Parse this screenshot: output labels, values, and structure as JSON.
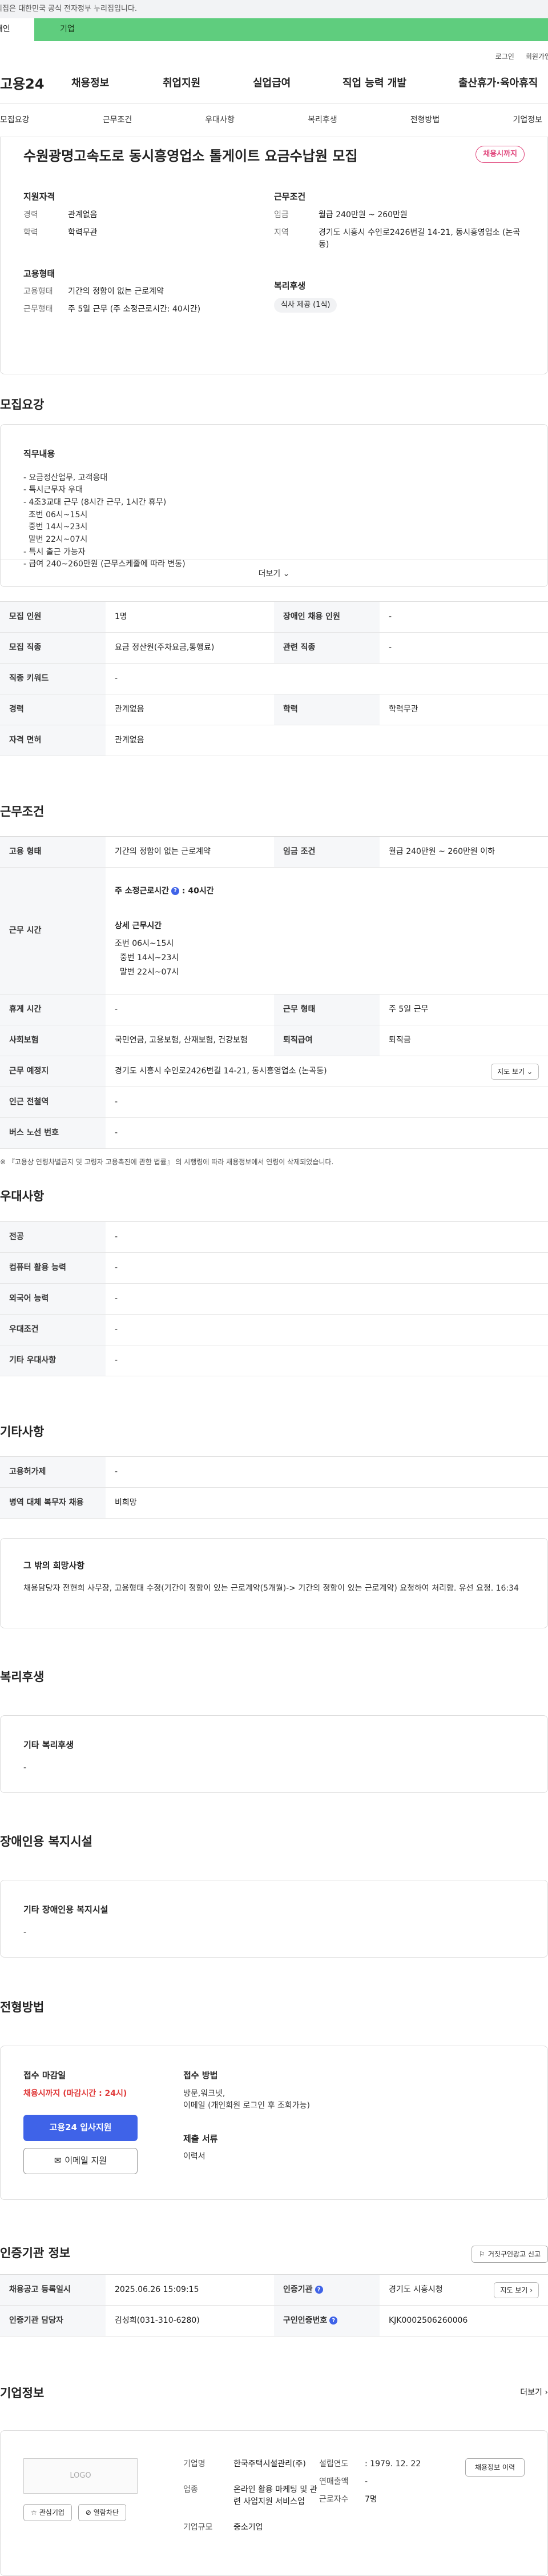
{
  "gov_banner": "이 누리집은 대한민국 공식 전자정부 누리집입니다.",
  "top_tabs": {
    "individual": "개인",
    "company": "기업"
  },
  "util": {
    "login": "로그인",
    "signup": "회원가입"
  },
  "logo": "고용24",
  "gnb": [
    "채용정보",
    "취업지원",
    "실업급여",
    "직업 능력 개발",
    "출산휴가·육아휴직"
  ],
  "subnav": [
    "모집요강",
    "근무조건",
    "우대사항",
    "복리후생",
    "전형방법",
    "기업정보"
  ],
  "summary": {
    "title": "수원광명고속도로 동시흥영업소 톨게이트 요금수납원 모집",
    "status": "채용시까지",
    "qual_title": "지원자격",
    "career_k": "경력",
    "career_v": "관계없음",
    "edu_k": "학력",
    "edu_v": "학력무관",
    "emp_title": "고용형태",
    "emptype_k": "고용형태",
    "emptype_v": "기간의 정함이 없는 근로계약",
    "worktype_k": "근무형태",
    "worktype_v": "주 5일 근무 (주 소정근로시간: 40시간)",
    "cond_title": "근무조건",
    "wage_k": "임금",
    "wage_v": "월급 240만원 ~ 260만원",
    "area_k": "지역",
    "area_v": "경기도 시흥시 수인로2426번길 14-21, 동시흥영업소 (논곡동)",
    "welfare_title": "복리후생",
    "welfare_chip": "식사 제공 (1식)"
  },
  "recruit": {
    "section_title": "모집요강",
    "duty_title": "직무내용",
    "duty_lines": [
      "- 요금정산업무, 고객응대",
      "- 특시근무자 우대",
      "- 4조3교대 근무 (8시간 근무, 1시간 휴무)",
      "  조번 06시~15시",
      "  중번 14시~23시",
      "  말번 22시~07시",
      "- 특시 출근 가능자",
      "- 급여 240~260만원 (근무스케줄에 따라 변동)"
    ],
    "more": "더보기",
    "rows": [
      {
        "k1": "모집 인원",
        "v1": "1명",
        "k2": "장애인 채용 인원",
        "v2": "-"
      },
      {
        "k1": "모집 직종",
        "v1": "요금 정산원(주차요금,통행료)",
        "k2": "관련 직종",
        "v2": "-"
      },
      {
        "k1": "직종 키워드",
        "v1": "-"
      },
      {
        "k1": "경력",
        "v1": "관계없음",
        "k2": "학력",
        "v2": "학력무관"
      },
      {
        "k1": "자격 면허",
        "v1": "관계없음"
      }
    ]
  },
  "work": {
    "section_title": "근무조건",
    "emp_k": "고용 형태",
    "emp_v": "기간의 정함이 없는 근로계약",
    "wage_k": "임금 조건",
    "wage_v": "월급 240만원 ~ 260만원 이하",
    "time_k": "근무 시간",
    "hours_label": "주 소정근로시간",
    "hours_value": "40시간",
    "detail_title": "상세 근무시간",
    "detail_lines": [
      "조번 06시~15시",
      "  중번 14시~23시",
      "  말번 22시~07시"
    ],
    "rest_k": "휴게 시간",
    "rest_v": "-",
    "form_k": "근무 형태",
    "form_v": "주 5일 근무",
    "ins_k": "사회보험",
    "ins_v": "국민연금, 고용보험, 산재보험, 건강보험",
    "ret_k": "퇴직급여",
    "ret_v": "퇴직금",
    "place_k": "근무 예정지",
    "place_v": "경기도 시흥시 수인로2426번길 14-21, 동시흥영업소 (논곡동)",
    "map_btn": "지도 보기",
    "station_k": "인근 전철역",
    "station_v": "-",
    "bus_k": "버스 노선 번호",
    "bus_v": "-",
    "notice": "※ 『고용상 연령차별금지 및 고령자 고용촉진에 관한 법률』 의 시행령에 따라 채용정보에서 연령이 삭제되었습니다."
  },
  "pref": {
    "section_title": "우대사항",
    "rows": [
      {
        "k": "전공",
        "v": "-"
      },
      {
        "k": "컴퓨터 활용 능력",
        "v": "-"
      },
      {
        "k": "외국어 능력",
        "v": "-"
      },
      {
        "k": "우대조건",
        "v": "-"
      },
      {
        "k": "기타 우대사항",
        "v": "-"
      }
    ]
  },
  "etc": {
    "section_title": "기타사항",
    "rows": [
      {
        "k": "고용허가제",
        "v": "-"
      },
      {
        "k": "병역 대체 복무자 채용",
        "v": "비희망"
      }
    ],
    "other_title": "그 밖의 희망사항",
    "other_text": "채용담당자 전현희 사무장, 고용형태 수정(기간이 정함이 있는 근로계약(5개월)-> 기간의 정함이 있는 근로계약) 요청하여 처리함. 유선 요청. 16:34"
  },
  "welfare": {
    "section_title": "복리후생",
    "box_title": "기타 복리후생",
    "box_value": "-"
  },
  "disability": {
    "section_title": "장애인용 복지시설",
    "box_title": "기타 장애인용 복지시설",
    "box_value": "-"
  },
  "process": {
    "section_title": "전형방법",
    "deadline_title": "접수 마감일",
    "deadline_value": "채용시까지 (마감시간 : 24시)",
    "apply_btn": "고용24 입사지원",
    "email_btn": "이메일 지원",
    "method_title": "접수 방법",
    "method_lines": [
      "방문,워크넷,",
      "이메일 (개인회원 로그인 후 조회가능)"
    ],
    "docs_title": "제출 서류",
    "docs_value": "이력서"
  },
  "certify": {
    "section_title": "인증기관 정보",
    "report_btn": "거짓구인광고 신고",
    "reg_k": "채용공고 등록일시",
    "reg_v": "2025.06.26 15:09:15",
    "org_k": "인증기관",
    "org_v": "경기도 시흥시청",
    "mgr_k": "인증기관 담당자",
    "mgr_v": "김성희(031-310-6280)",
    "no_k": "구인인증번호",
    "no_v": "KJK0002506260006",
    "map_btn": "지도 보기"
  },
  "company": {
    "section_title": "기업정보",
    "more": "더보기",
    "logo_text": "LOGO",
    "fav_btn": "관심기업",
    "block_btn": "열람차단",
    "name_k": "기업명",
    "name_v": "한국주택시설관리(주)",
    "biz_k": "업종",
    "biz_v": "온라인 활용 마케팅 및 관련 사업지원 서비스업",
    "size_k": "기업규모",
    "size_v": "중소기업",
    "found_k": "설립연도",
    "found_v": ": 1979. 12. 22",
    "sales_k": "연매출액",
    "sales_v": "-",
    "staff_k": "근로자수",
    "staff_v": "7명",
    "hr_btn": "채용정보 이력"
  }
}
